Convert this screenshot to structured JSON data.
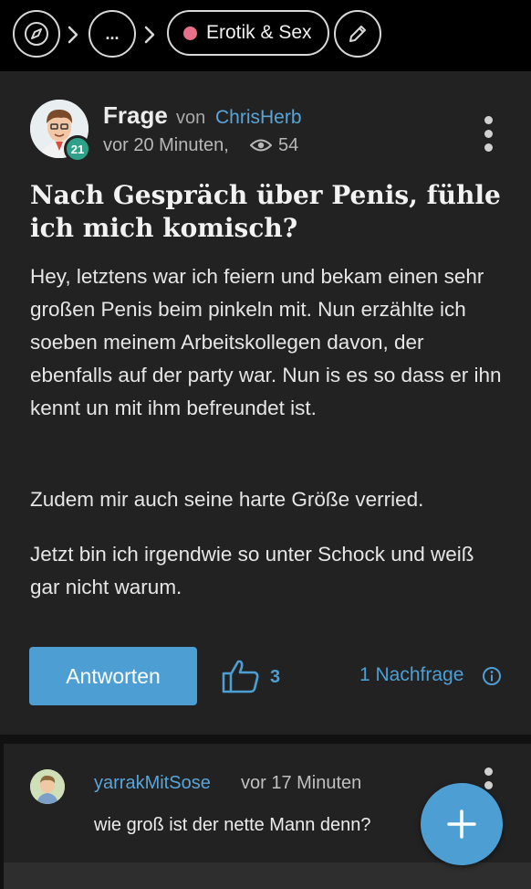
{
  "breadcrumb": {
    "more_label": "...",
    "category_label": "Erotik & Sex",
    "category_color": "#e8708a"
  },
  "question": {
    "type_label": "Frage",
    "von_label": "von",
    "author": "ChrisHerb",
    "badge": "21",
    "time": "vor 20 Minuten,",
    "views": "54",
    "title": "Nach Gespräch über Penis, fühle ich mich komisch?",
    "paragraphs": [
      "Hey, letztens war ich feiern und bekam einen sehr großen Penis beim pinkeln mit. Nun erzählte ich soeben meinem Arbeitskollegen davon, der ebenfalls auf der party war. Nun is es so dass er ihn kennt un mit ihm befreundet ist.",
      "Zudem mir auch seine harte Größe verried.",
      "Jetzt bin ich irgendwie so unter Schock und weiß gar nicht warum."
    ],
    "answer_button": "Antworten",
    "likes": "3",
    "followup": "1 Nachfrage"
  },
  "comment": {
    "author": "yarrakMitSose",
    "time": "vor 17 Minuten",
    "text": "wie groß ist der nette Mann denn?"
  },
  "icons": {
    "home": "compass-icon",
    "edit": "pencil-icon",
    "views": "eye-icon",
    "like": "thumbs-up-icon",
    "info": "info-icon",
    "fab": "plus-icon"
  },
  "colors": {
    "accent": "#4d9fd3",
    "card": "#222222",
    "badge": "#2fa188"
  }
}
